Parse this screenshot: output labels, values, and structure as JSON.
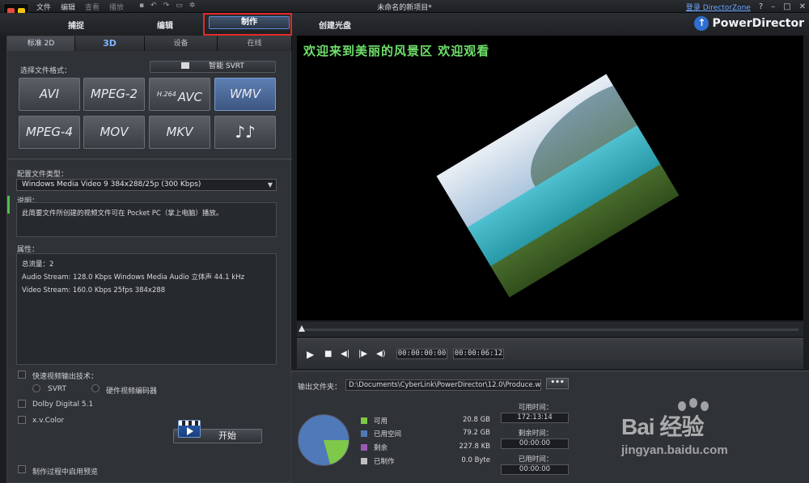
{
  "window": {
    "title": "未命名的新项目*",
    "login_link": "登录 DirectorZone",
    "help": "?",
    "minimize": "–",
    "maximize": "□",
    "close": "✕"
  },
  "menu": {
    "items": [
      "文件",
      "编辑",
      "查看",
      "播放"
    ]
  },
  "modes": {
    "capture": "捕捉",
    "edit": "编辑",
    "produce": "制作",
    "disc": "创建光盘"
  },
  "brand": {
    "name": "PowerDirector",
    "icon": "up-arrow-circle-icon"
  },
  "tabs": [
    "标准 2D",
    "3D",
    "设备",
    "在线"
  ],
  "format": {
    "label": "选择文件格式：",
    "svrt_button": "智能 SVRT",
    "buttons": [
      {
        "label": "AVI",
        "sup": ""
      },
      {
        "label": "MPEG-2",
        "sup": ""
      },
      {
        "label": "AVC",
        "sup": "H.264"
      },
      {
        "label": "WMV",
        "sup": ""
      },
      {
        "label": "MPEG-4",
        "sup": ""
      },
      {
        "label": "MOV",
        "sup": ""
      },
      {
        "label": "MKV",
        "sup": ""
      },
      {
        "label": "♪♪",
        "sup": ""
      }
    ],
    "selected": "WMV"
  },
  "profile": {
    "label": "配置文件类型：",
    "value": "Windows Media Video 9 384x288/25p (300 Kbps)"
  },
  "description": {
    "label": "说明：",
    "text": "此简要文件所创建的视频文件可在 Pocket PC（掌上电脑）播放。"
  },
  "properties": {
    "label": "属性：",
    "lines": [
      "总流量：2",
      "Audio Stream:  128.0 Kbps  Windows Media Audio  立体声  44.1 kHz",
      "Video Stream:  160.0 Kbps  25fps   384x288"
    ]
  },
  "options": {
    "fast_render": "快速视频输出技术：",
    "svrt": "SVRT",
    "hw_encoder": "硬件视频编码器",
    "dolby": "Dolby Digital 5.1",
    "xvcolor": "x.v.Color",
    "preview_during": "制作过程中启用预览"
  },
  "start_button": "开始",
  "preview": {
    "overlay_text": "欢迎来到美丽的风景区 欢迎观看"
  },
  "player": {
    "current_time": "00:00:00:00",
    "total_time": "00:00:06:12"
  },
  "output": {
    "label": "输出文件夹：",
    "path": "D:\\Documents\\CyberLink\\PowerDirector\\12.0\\Produce.wmv",
    "browse": "•••"
  },
  "disk": {
    "legend": [
      {
        "name": "可用",
        "value": "20.8  GB",
        "color": "#7ec84a"
      },
      {
        "name": "已用空间",
        "value": "79.2  GB",
        "color": "#4f79b8"
      },
      {
        "name": "剩余",
        "value": "227.8  KB",
        "color": "#9b59b6"
      },
      {
        "name": "已制作",
        "value": "0.0  Byte",
        "color": "#bfbfbf"
      }
    ],
    "available_time_label": "可用时间：",
    "available_time": "172:13:14",
    "remaining_time_label": "剩余时间：",
    "remaining_time": "00:00:00",
    "used_time_label": "已用时间：",
    "used_time": "00:00:00"
  },
  "watermark": {
    "brand": "Bai  经验",
    "url": "jingyan.baidu.com"
  }
}
